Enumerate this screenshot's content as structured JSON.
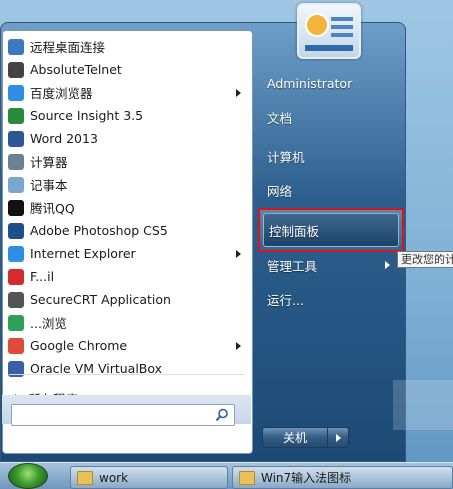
{
  "start_menu": {
    "programs": [
      {
        "label": "远程桌面连接",
        "icon": "remote-desktop-icon",
        "arrow": false
      },
      {
        "label": "AbsoluteTelnet",
        "icon": "telnet-icon",
        "arrow": false
      },
      {
        "label": "百度浏览器",
        "icon": "baidu-browser-icon",
        "arrow": true
      },
      {
        "label": "Source Insight 3.5",
        "icon": "source-insight-icon",
        "arrow": false
      },
      {
        "label": "Word 2013",
        "icon": "word-icon",
        "arrow": false
      },
      {
        "label": "计算器",
        "icon": "calculator-icon",
        "arrow": false
      },
      {
        "label": "记事本",
        "icon": "notepad-icon",
        "arrow": false
      },
      {
        "label": "腾讯QQ",
        "icon": "qq-icon",
        "arrow": false
      },
      {
        "label": "Adobe Photoshop CS5",
        "icon": "photoshop-icon",
        "arrow": false
      },
      {
        "label": "Internet Explorer",
        "icon": "ie-icon",
        "arrow": true
      },
      {
        "label": "F...il",
        "icon": "app-icon",
        "arrow": false
      },
      {
        "label": "SecureCRT Application",
        "icon": "securecrt-icon",
        "arrow": false
      },
      {
        "label": "...浏览",
        "icon": "browser-icon",
        "arrow": false
      },
      {
        "label": "Google Chrome",
        "icon": "chrome-icon",
        "arrow": true
      },
      {
        "label": "Oracle VM VirtualBox",
        "icon": "virtualbox-icon",
        "arrow": false
      }
    ],
    "all_programs": "所有程序",
    "search_placeholder": "",
    "right_items": [
      {
        "label": "Administrator",
        "arrow": false
      },
      {
        "label": "文档",
        "arrow": false
      },
      {
        "label": "计算机",
        "arrow": false
      },
      {
        "label": "网络",
        "arrow": false
      },
      {
        "label": "控制面板",
        "arrow": false
      },
      {
        "label": "管理工具",
        "arrow": true
      },
      {
        "label": "运行...",
        "arrow": false
      }
    ],
    "tooltip": "更改您的计",
    "shutdown_label": "关机"
  },
  "taskbar": {
    "buttons": [
      {
        "label": "work"
      },
      {
        "label": "Win7输入法图标"
      }
    ]
  },
  "colors": {
    "highlight_border": "#d9141c",
    "menu_blue": "#1c4a75"
  }
}
